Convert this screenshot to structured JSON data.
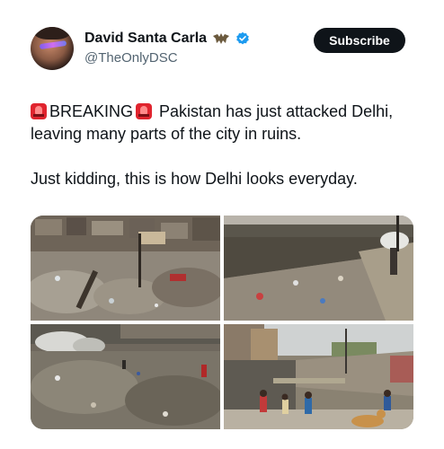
{
  "author": {
    "display_name": "David Santa Carla",
    "handle": "@TheOnlyDSC",
    "badge_icon": "bat-icon",
    "verified_icon": "verified-badge-icon",
    "verified_color": "#1d9bf0"
  },
  "actions": {
    "subscribe_label": "Subscribe"
  },
  "tweet": {
    "breaking_label": "BREAKING",
    "line1_rest": " Pakistan has just attacked Delhi, leaving many parts of the city in ruins.",
    "line2": "Just kidding, this is how Delhi looks everyday.",
    "emoji_icon": "rotating-light-icon"
  },
  "media": {
    "photos": [
      {
        "name": "photo-slum-rubble"
      },
      {
        "name": "photo-drain-garbage"
      },
      {
        "name": "photo-garbage-dump"
      },
      {
        "name": "photo-canal-children"
      }
    ]
  }
}
